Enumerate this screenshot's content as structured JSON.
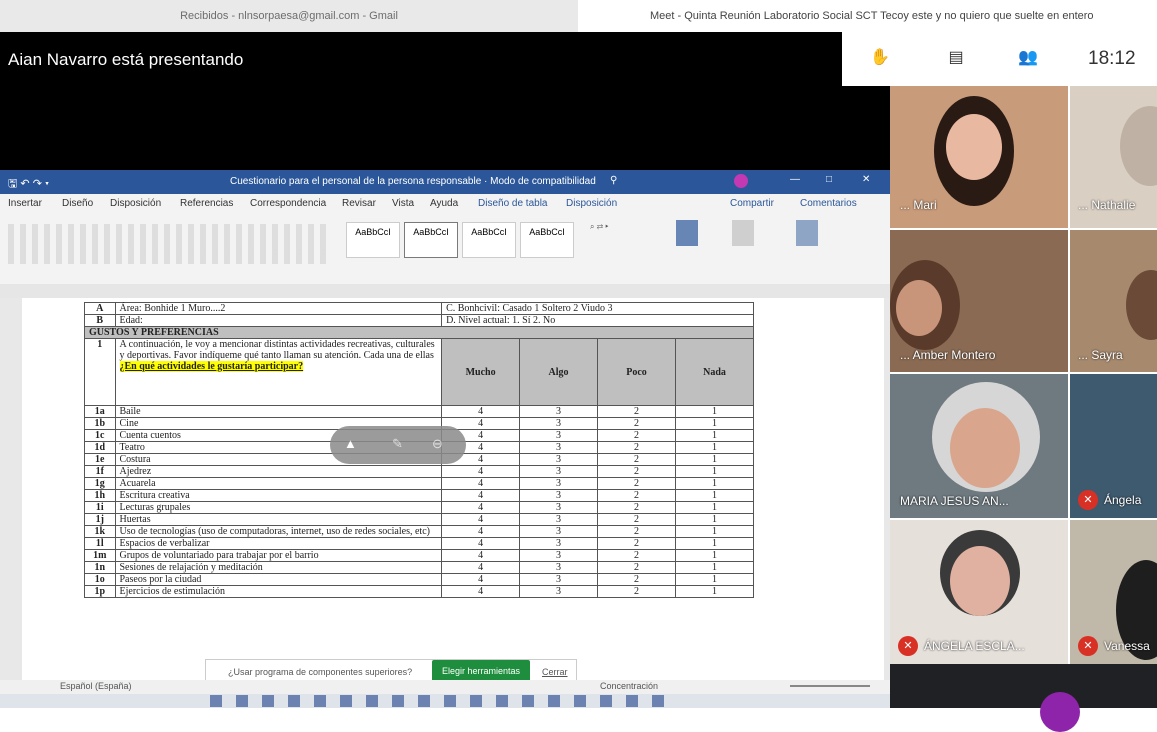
{
  "browser": {
    "tab_left": "Recibidos - nlnsorpaesa@gmail.com - Gmail",
    "tab_right": "Meet - Quinta Reunión Laboratorio Social SCT Tecoy este y no quiero que suelte en entero"
  },
  "presentation": {
    "presenter_text": "Aian Navarro está presentando"
  },
  "meet_header": {
    "clock": "18:12",
    "icons": [
      "raised-hand-icon",
      "chat-icon",
      "people-icon"
    ]
  },
  "word": {
    "title": "Cuestionario para el personal de la persona responsable · Modo de compatibilidad",
    "tabs": [
      "Insertar",
      "Diseño",
      "Disposición",
      "Referencias",
      "Correspondencia",
      "Revisar",
      "Vista",
      "Ayuda",
      "Diseño de tabla",
      "Disposición"
    ],
    "share": "Compartir",
    "comments": "Comentarios",
    "styles": [
      "AaBbCcI",
      "AaBbCcI",
      "AaBbCcI",
      "AaBbCcI"
    ],
    "status_left": "Español (España)",
    "status_right": "Concentración"
  },
  "table": {
    "header_rows": [
      {
        "code": "A",
        "text": "Área: Bonhide 1   Muro....2",
        "right": "C. Bonhcivil:  Casado 1   Soltero 2   Viudo 3"
      },
      {
        "code": "B",
        "text": "Edad:",
        "right": "D. Nivel actual:  1. Sí   2. No"
      }
    ],
    "section_title": "GUSTOS Y PREFERENCIAS",
    "question_code": "1",
    "question_text": "A continuación, le voy a mencionar distintas actividades recreativas, culturales y deportivas. Favor indíqueme qué tanto llaman su atención. Cada una de ellas",
    "question_highlight": "¿En qué actividades le gustaría participar?",
    "columns": [
      "Mucho",
      "Algo",
      "Poco",
      "Nada"
    ],
    "rows": [
      {
        "code": "1a",
        "label": "Baile",
        "v": [
          "4",
          "3",
          "2",
          "1"
        ]
      },
      {
        "code": "1b",
        "label": "Cine",
        "v": [
          "4",
          "3",
          "2",
          "1"
        ]
      },
      {
        "code": "1c",
        "label": "Cuenta cuentos",
        "v": [
          "4",
          "3",
          "2",
          "1"
        ]
      },
      {
        "code": "1d",
        "label": "Teatro",
        "v": [
          "4",
          "3",
          "2",
          "1"
        ]
      },
      {
        "code": "1e",
        "label": "Costura",
        "v": [
          "4",
          "3",
          "2",
          "1"
        ]
      },
      {
        "code": "1f",
        "label": "Ajedrez",
        "v": [
          "4",
          "3",
          "2",
          "1"
        ]
      },
      {
        "code": "1g",
        "label": "Acuarela",
        "v": [
          "4",
          "3",
          "2",
          "1"
        ]
      },
      {
        "code": "1h",
        "label": "Escritura creativa",
        "v": [
          "4",
          "3",
          "2",
          "1"
        ]
      },
      {
        "code": "1i",
        "label": "Lecturas grupales",
        "v": [
          "4",
          "3",
          "2",
          "1"
        ]
      },
      {
        "code": "1j",
        "label": "Huertas",
        "v": [
          "4",
          "3",
          "2",
          "1"
        ]
      },
      {
        "code": "1k",
        "label": "Uso de tecnologías (uso de computadoras, internet, uso de redes sociales, etc)",
        "v": [
          "4",
          "3",
          "2",
          "1"
        ]
      },
      {
        "code": "1l",
        "label": "Espacios de verbalizar",
        "v": [
          "4",
          "3",
          "2",
          "1"
        ]
      },
      {
        "code": "1m",
        "label": "Grupos de voluntariado para trabajar por el barrio",
        "v": [
          "4",
          "3",
          "2",
          "1"
        ]
      },
      {
        "code": "1n",
        "label": "Sesiones de relajación y meditación",
        "v": [
          "4",
          "3",
          "2",
          "1"
        ]
      },
      {
        "code": "1o",
        "label": "Paseos por la ciudad",
        "v": [
          "4",
          "3",
          "2",
          "1"
        ]
      },
      {
        "code": "1p",
        "label": "Ejercicios de estimulación",
        "v": [
          "4",
          "3",
          "2",
          "1"
        ]
      }
    ]
  },
  "notification": {
    "text": "¿Usar programa de componentes superiores?",
    "button": "Elegir herramientas",
    "dismiss": "Cerrar"
  },
  "participants": [
    {
      "name": "... Mari",
      "muted": false
    },
    {
      "name": "... Nathalie",
      "muted": false
    },
    {
      "name": "... Amber Montero",
      "muted": false
    },
    {
      "name": "... Sayra",
      "muted": false
    },
    {
      "name": "MARIA JESUS AN...",
      "muted": false
    },
    {
      "name": "Ángela",
      "muted": true
    },
    {
      "name": "ÁNGELA ESCLA...",
      "muted": true
    },
    {
      "name": "Vanessa",
      "muted": true
    }
  ]
}
